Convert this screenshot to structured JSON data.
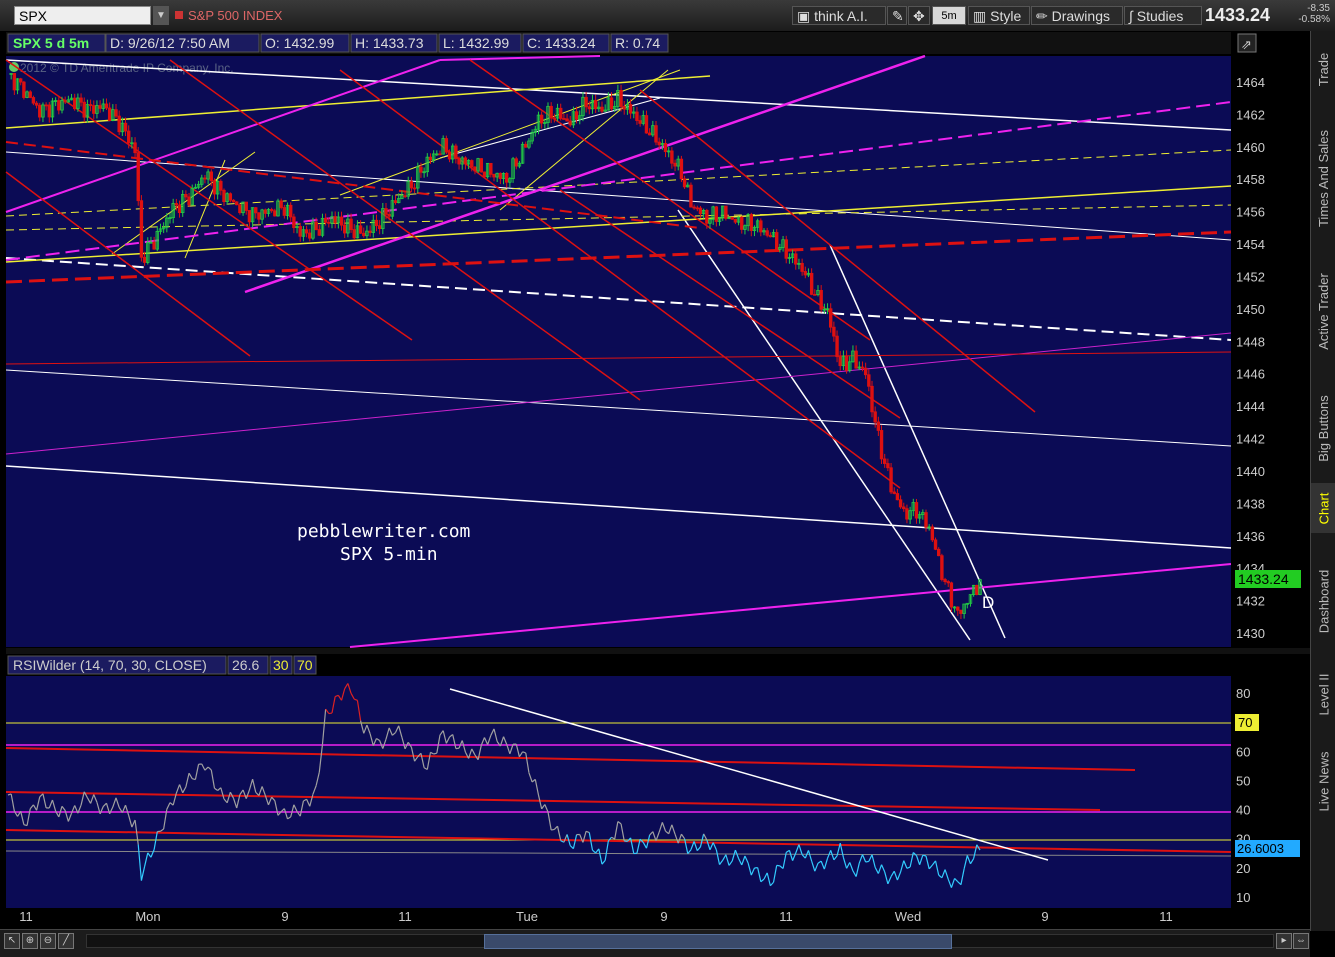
{
  "toolbar": {
    "symbol": "SPX",
    "index_name": "S&P 500 INDEX",
    "think_label": "think A.I.",
    "interval_label": "5m",
    "style_label": "Style",
    "drawings_label": "Drawings",
    "studies_label": "Studies",
    "last_price": "1433.24",
    "net_change": "-8.35",
    "pct_change": "-0.58%"
  },
  "chart_header": {
    "title": "SPX 5 d 5m",
    "date": "D: 9/26/12 7:50 AM",
    "open": "O: 1432.99",
    "high": "H: 1433.73",
    "low": "L: 1432.99",
    "close": "C: 1433.24",
    "range": "R: 0.74",
    "copyright": "2012 © TD Ameritrade IP Company, Inc."
  },
  "annotation": {
    "line1": "pebblewriter.com",
    "line2": "SPX 5-min",
    "marker": "D"
  },
  "price_axis": {
    "ticks": [
      "1464",
      "1462",
      "1460",
      "1458",
      "1456",
      "1454",
      "1452",
      "1450",
      "1448",
      "1446",
      "1444",
      "1442",
      "1440",
      "1438",
      "1436",
      "1434",
      "1432",
      "1430"
    ],
    "last_badge": "1433.24"
  },
  "rsi": {
    "label": "RSIWilder (14, 70, 30, CLOSE)",
    "value": "26.6",
    "ob": "30",
    "os": "70",
    "ticks": [
      "80",
      "70",
      "60",
      "50",
      "40",
      "30",
      "20",
      "10"
    ],
    "badge_70": "70",
    "badge_value": "26.6003"
  },
  "time_axis": [
    "11",
    "Mon",
    "9",
    "11",
    "Tue",
    "9",
    "11",
    "Wed",
    "9",
    "11"
  ],
  "sidebar": [
    "Trade",
    "Times And Sales",
    "Active Trader",
    "Big Buttons",
    "Chart",
    "Dashboard",
    "Level II",
    "Live News"
  ],
  "colors": {
    "background": "#0b0b55",
    "up": "#22cc44",
    "down": "#dd1111",
    "magenta": "#ee22ee",
    "yellow": "#eeee33",
    "red": "#dd1111",
    "white": "#ffffff",
    "rsi_line": "#a0a0a0"
  },
  "chart_data": {
    "type": "candlestick",
    "title": "SPX 5 d 5m",
    "ylim": [
      1429,
      1465
    ],
    "x_labels": [
      "11",
      "Mon",
      "9",
      "11",
      "Tue",
      "9",
      "11",
      "Wed",
      "9",
      "11"
    ],
    "close_path": [
      [
        0,
        1464.5
      ],
      [
        5,
        1463.5
      ],
      [
        10,
        1462.2
      ],
      [
        15,
        1462.6
      ],
      [
        20,
        1462.9
      ],
      [
        25,
        1462.3
      ],
      [
        30,
        1462.5
      ],
      [
        35,
        1461.5
      ],
      [
        40,
        1459.8
      ],
      [
        42,
        1453.1
      ],
      [
        47,
        1454.5
      ],
      [
        52,
        1456.2
      ],
      [
        57,
        1456.9
      ],
      [
        62,
        1458.3
      ],
      [
        67,
        1457.2
      ],
      [
        72,
        1456.4
      ],
      [
        77,
        1455.8
      ],
      [
        82,
        1456.0
      ],
      [
        87,
        1456.3
      ],
      [
        92,
        1454.6
      ],
      [
        97,
        1454.9
      ],
      [
        102,
        1455.6
      ],
      [
        107,
        1455.0
      ],
      [
        112,
        1454.6
      ],
      [
        117,
        1455.4
      ],
      [
        122,
        1456.6
      ],
      [
        127,
        1457.6
      ],
      [
        132,
        1459.1
      ],
      [
        137,
        1460.0
      ],
      [
        142,
        1459.2
      ],
      [
        147,
        1458.8
      ],
      [
        152,
        1458.4
      ],
      [
        157,
        1458.0
      ],
      [
        162,
        1459.7
      ],
      [
        167,
        1461.6
      ],
      [
        172,
        1462.1
      ],
      [
        177,
        1461.5
      ],
      [
        182,
        1462.7
      ],
      [
        187,
        1462.3
      ],
      [
        192,
        1462.9
      ],
      [
        197,
        1462.0
      ],
      [
        202,
        1461.0
      ],
      [
        207,
        1459.8
      ],
      [
        212,
        1458.4
      ],
      [
        215,
        1456.5
      ],
      [
        220,
        1455.6
      ],
      [
        225,
        1455.9
      ],
      [
        230,
        1455.3
      ],
      [
        235,
        1455.2
      ],
      [
        240,
        1454.5
      ],
      [
        245,
        1453.5
      ],
      [
        250,
        1452.5
      ],
      [
        255,
        1450.6
      ],
      [
        258,
        1449.8
      ],
      [
        262,
        1446.5
      ],
      [
        266,
        1446.9
      ],
      [
        270,
        1446.0
      ],
      [
        274,
        1442.0
      ],
      [
        278,
        1439.0
      ],
      [
        282,
        1437.4
      ],
      [
        286,
        1437.6
      ],
      [
        290,
        1436.5
      ],
      [
        295,
        1433.1
      ],
      [
        299,
        1431.1
      ],
      [
        302,
        1432.0
      ],
      [
        306,
        1433.2
      ]
    ],
    "rsi": {
      "name": "RSIWilder (14, 70, 30, CLOSE)",
      "last": 26.6003,
      "overbought": 70,
      "oversold": 30,
      "ylim": [
        10,
        85
      ],
      "path": [
        [
          0,
          45
        ],
        [
          5,
          35
        ],
        [
          10,
          44
        ],
        [
          15,
          40
        ],
        [
          20,
          38
        ],
        [
          25,
          45
        ],
        [
          30,
          40
        ],
        [
          35,
          42
        ],
        [
          40,
          35
        ],
        [
          42,
          18
        ],
        [
          47,
          30
        ],
        [
          52,
          44
        ],
        [
          57,
          50
        ],
        [
          62,
          56
        ],
        [
          67,
          45
        ],
        [
          72,
          43
        ],
        [
          77,
          48
        ],
        [
          82,
          44
        ],
        [
          87,
          38
        ],
        [
          92,
          40
        ],
        [
          97,
          46
        ],
        [
          100,
          72
        ],
        [
          105,
          80
        ],
        [
          108,
          82
        ],
        [
          112,
          68
        ],
        [
          117,
          62
        ],
        [
          122,
          68
        ],
        [
          127,
          60
        ],
        [
          132,
          55
        ],
        [
          137,
          66
        ],
        [
          142,
          62
        ],
        [
          147,
          58
        ],
        [
          152,
          66
        ],
        [
          157,
          62
        ],
        [
          162,
          60
        ],
        [
          167,
          45
        ],
        [
          172,
          33
        ],
        [
          177,
          28
        ],
        [
          182,
          32
        ],
        [
          187,
          22
        ],
        [
          192,
          35
        ],
        [
          197,
          26
        ],
        [
          202,
          30
        ],
        [
          207,
          34
        ],
        [
          212,
          30
        ],
        [
          215,
          26
        ],
        [
          220,
          30
        ],
        [
          225,
          22
        ],
        [
          230,
          24
        ],
        [
          235,
          19
        ],
        [
          240,
          15
        ],
        [
          245,
          24
        ],
        [
          250,
          26
        ],
        [
          255,
          20
        ],
        [
          258,
          23
        ],
        [
          262,
          26
        ],
        [
          266,
          18
        ],
        [
          270,
          24
        ],
        [
          274,
          20
        ],
        [
          278,
          16
        ],
        [
          282,
          20
        ],
        [
          286,
          24
        ],
        [
          290,
          22
        ],
        [
          295,
          17
        ],
        [
          299,
          14
        ],
        [
          302,
          22
        ],
        [
          306,
          26.6
        ]
      ]
    }
  }
}
